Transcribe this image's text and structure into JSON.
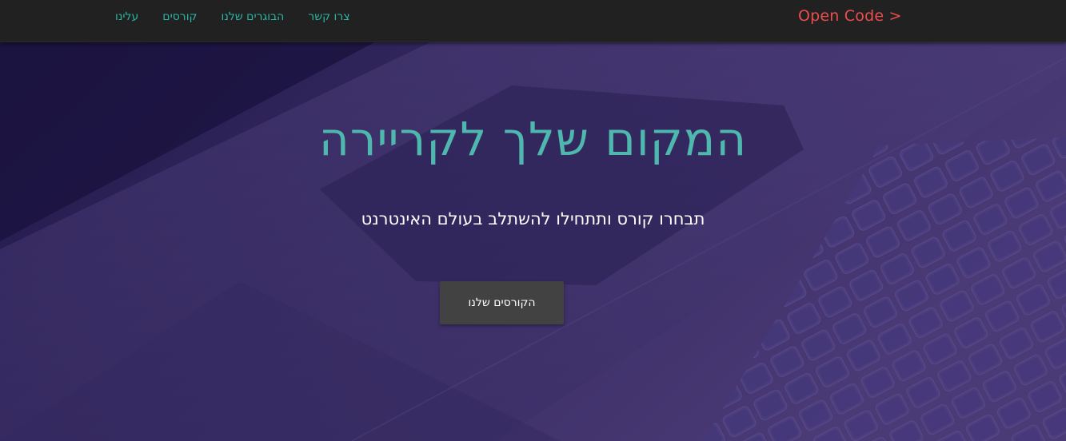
{
  "navbar": {
    "brand": "Open Code >",
    "links": [
      {
        "label": "עלינו"
      },
      {
        "label": "קורסים"
      },
      {
        "label": "הבוגרים שלנו"
      },
      {
        "label": "צרו קשר"
      }
    ]
  },
  "hero": {
    "title": "המקום שלך לקריירה",
    "subtitle": "תבחרו קורס ותתחילו להשתלב בעולם האינטרנט",
    "cta_label": "הקורסים שלנו",
    "background_image": "laptop-keyboard-image"
  },
  "colors": {
    "navbar_bg": "#212121",
    "brand": "#ee4d4d",
    "nav_link": "#2bb5a4",
    "hero_overlay": "#3a2d63",
    "title": "#4fb8ae",
    "button_bg": "#424242"
  }
}
